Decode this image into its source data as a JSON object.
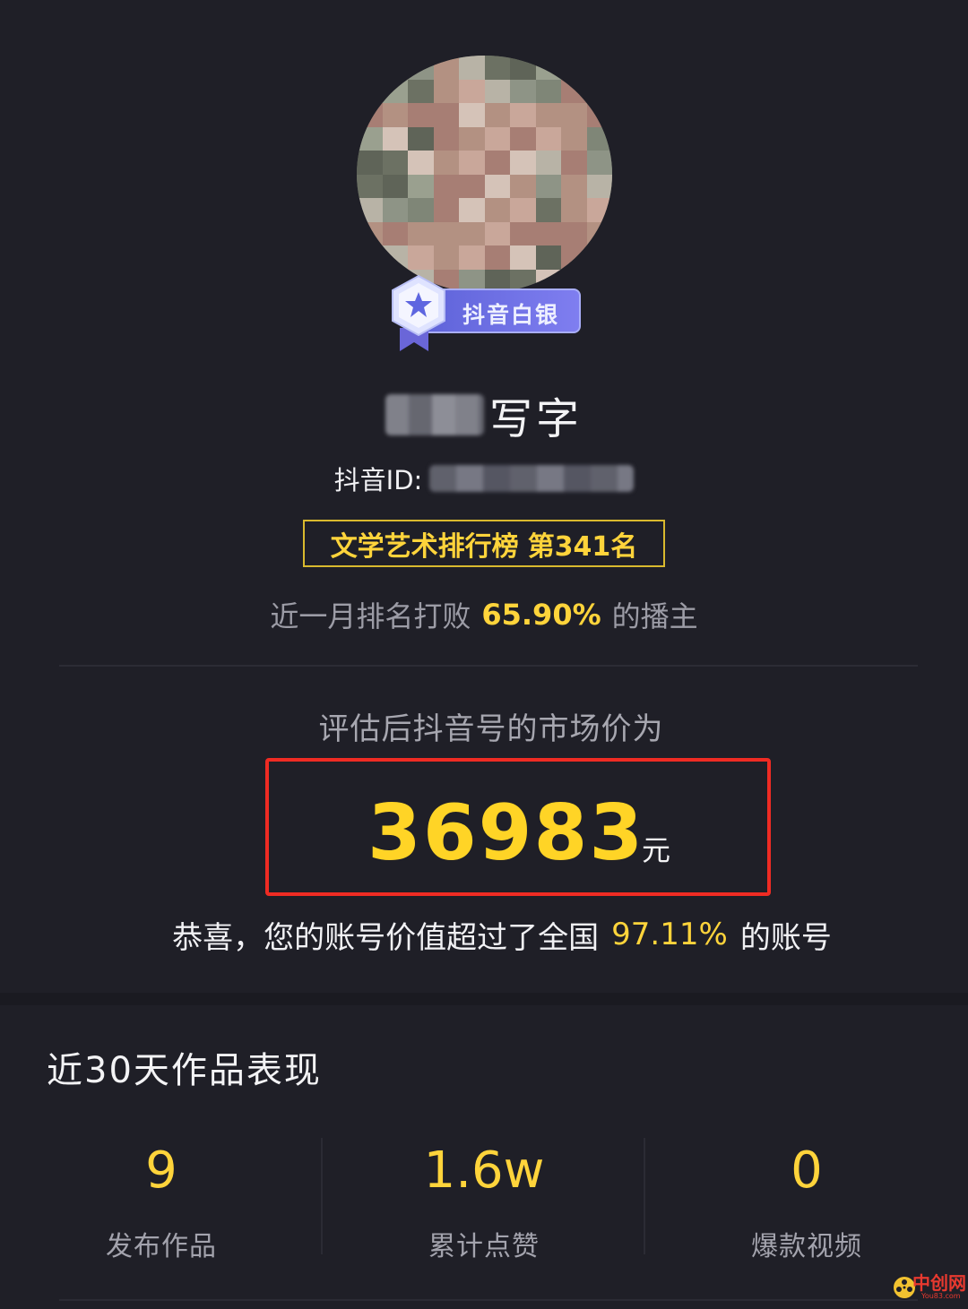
{
  "profile": {
    "badge_label": "抖音白银",
    "nickname_visible": "写字",
    "id_label": "抖音ID:",
    "rank": {
      "category": "文学艺术排行榜",
      "position": "第341名"
    },
    "beat": {
      "prefix": "近一月排名打败",
      "percent": "65.90%",
      "suffix": "的播主"
    }
  },
  "valuation": {
    "caption": "评估后抖音号的市场价为",
    "amount": "36983",
    "unit": "元",
    "congrats_prefix": "恭喜，您的账号价值超过了全国",
    "congrats_percent": "97.11%",
    "congrats_suffix": "的账号"
  },
  "stats": {
    "title": "近30天作品表现",
    "items": [
      {
        "value": "9",
        "label": "发布作品"
      },
      {
        "value": "1.6w",
        "label": "累计点赞"
      },
      {
        "value": "0",
        "label": "爆款视频"
      }
    ]
  },
  "watermark": {
    "text": "中创网",
    "sub": "You83.com"
  },
  "colors": {
    "background": "#1f1f27",
    "highlight_yellow": "#ffd43b",
    "red_frame": "#ef2b23",
    "badge_purple": "#6c6ee6"
  }
}
